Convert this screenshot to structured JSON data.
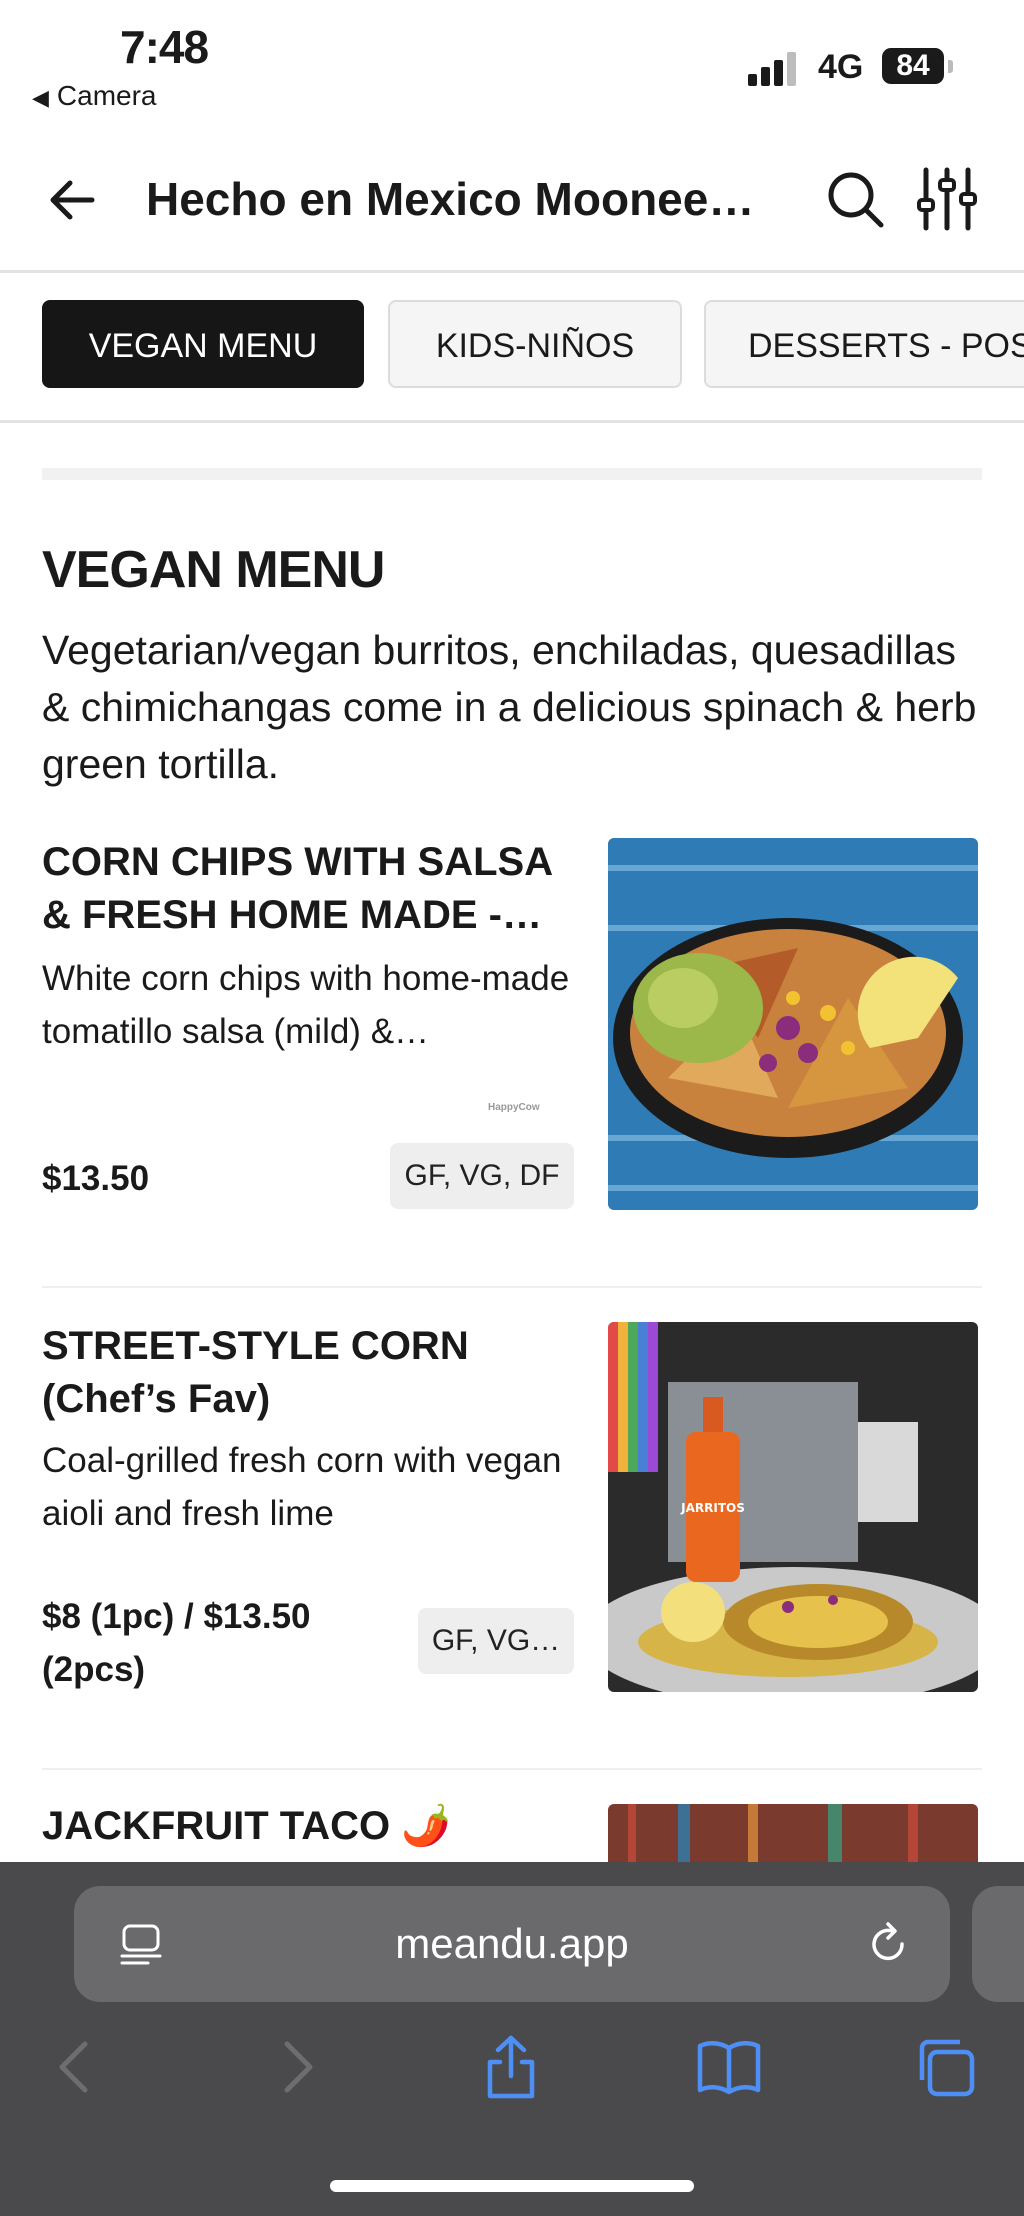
{
  "status": {
    "time": "7:48",
    "back_app": "Camera",
    "network": "4G",
    "battery": "84"
  },
  "header": {
    "title": "Hecho en Mexico Moonee…"
  },
  "tabs": [
    {
      "label": "VEGAN MENU",
      "active": true
    },
    {
      "label": "KIDS-NIÑOS",
      "active": false
    },
    {
      "label": "DESSERTS - POS",
      "active": false
    }
  ],
  "section": {
    "title": "VEGAN MENU",
    "description": "Vegetarian/vegan burritos, enchiladas, quesadillas & chimichangas come in a delicious spinach & herb green tortilla."
  },
  "items": [
    {
      "name": "CORN CHIPS WITH SALSA & FRESH HOME MADE -…",
      "description": "White corn chips with home-made tomatillo salsa (mild) &…",
      "price": "$13.50",
      "tags": "GF, VG, DF",
      "watermark": "HappyCow"
    },
    {
      "name": "STREET-STYLE CORN (Chef’s Fav)",
      "description": "Coal-grilled fresh corn with vegan aioli and fresh lime",
      "price": "$8 (1pc) / $13.50 (2pcs)",
      "tags": "GF, VG…",
      "image_text": "JARRITOS"
    },
    {
      "name": "JACKFRUIT TACO 🌶️"
    }
  ],
  "browser": {
    "url": "meandu.app"
  },
  "icons": {
    "back": "back-arrow-icon",
    "search": "search-icon",
    "filter": "filter-sliders-icon",
    "reader": "reader-icon",
    "reload": "reload-icon",
    "nav_back": "chevron-left-icon",
    "nav_forward": "chevron-right-icon",
    "share": "share-icon",
    "bookmarks": "bookmarks-icon",
    "tabs": "tabs-icon"
  },
  "colors": {
    "active_tab": "#161616",
    "toolbar_bg": "#4a4a4c",
    "toolbar_icon": "#4d8ff5"
  }
}
